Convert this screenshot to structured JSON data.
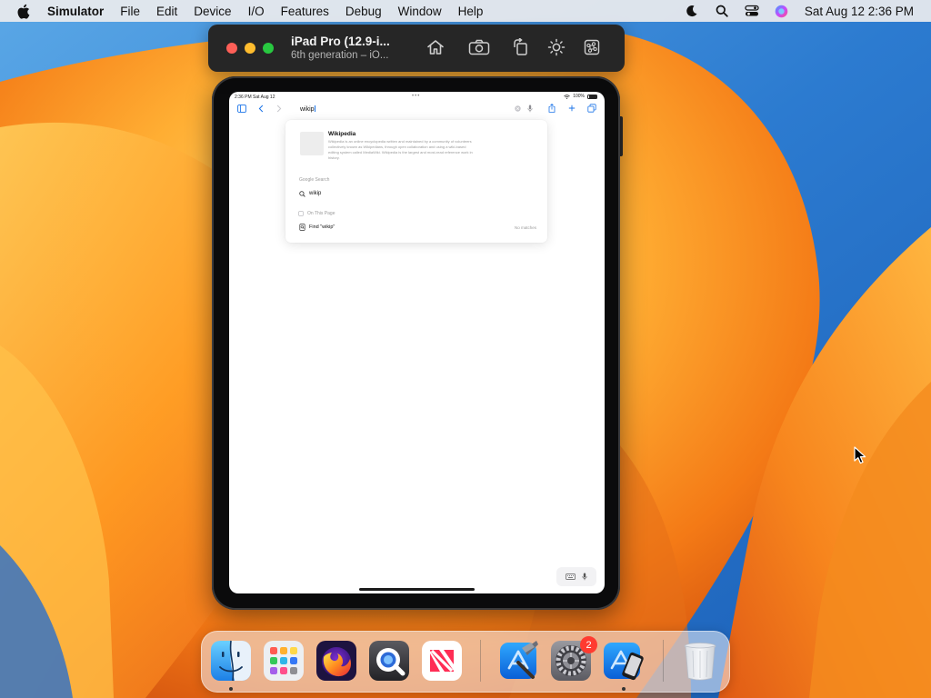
{
  "menubar": {
    "apple_icon": "apple-logo",
    "app_name": "Simulator",
    "items": [
      "File",
      "Edit",
      "Device",
      "I/O",
      "Features",
      "Debug",
      "Window",
      "Help"
    ],
    "status_icons": [
      "moon-icon",
      "search-icon",
      "control-center-icon",
      "siri-icon"
    ],
    "clock": "Sat Aug 12  2:36 PM"
  },
  "simulator": {
    "title": "iPad Pro (12.9-i...",
    "subtitle": "6th generation – iO...",
    "toolbar_icons": [
      "home-icon",
      "screenshot-icon",
      "rotate-icon",
      "appearance-icon",
      "command-icon"
    ]
  },
  "ipad": {
    "status_time": "2:36 PM  Sat Aug 12",
    "battery": "100%",
    "url_text": "wikip",
    "suggestion": {
      "title": "Wikipedia",
      "desc_line1": "Wikipedia is an online encyclopedia written and maintained by a community of volunteers",
      "desc_line2": "collectively known as Wikipedians, through open collaboration and using a wiki-based",
      "desc_line3": "editing system called MediaWiki. Wikipedia is the largest and most-read reference work in",
      "desc_line4": "history."
    },
    "google_section": "Google Search",
    "google_query": "wikip",
    "page_section": "On This Page",
    "find_text": "Find \"wikip\"",
    "no_matches": "No matches"
  },
  "dock": {
    "apps": [
      "finder",
      "launchpad",
      "firefox",
      "quicktime-player",
      "news",
      "xcode",
      "system-settings",
      "simulator",
      "trash"
    ],
    "badge": "2"
  },
  "colors": {
    "menubar_bg": "#ececee",
    "simulator_titlebar": "#262626",
    "close": "#fe5f57",
    "minimize": "#febc2e",
    "maximize": "#28c840",
    "badge": "#ff3b30",
    "safari_blue": "#1a73e8"
  }
}
